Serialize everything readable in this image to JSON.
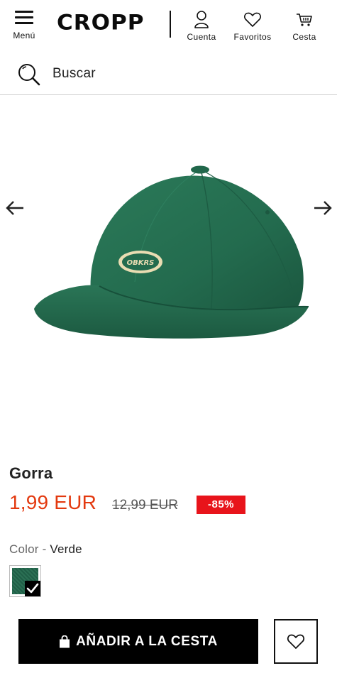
{
  "header": {
    "menu_label": "Menú",
    "logo_text": "CROPP",
    "account_label": "Cuenta",
    "favorites_label": "Favoritos",
    "cart_label": "Cesta"
  },
  "search": {
    "placeholder": "Buscar",
    "icon": "search-icon"
  },
  "gallery": {
    "prev_icon": "arrow-left-icon",
    "next_icon": "arrow-right-icon",
    "image_subject": "green-cap",
    "patch_text": "OBKRS"
  },
  "product": {
    "name": "Gorra",
    "price_current": "1,99 EUR",
    "price_old": "12,99 EUR",
    "discount": "-85%",
    "color_key": "Color",
    "color_separator": "-",
    "color_value": "Verde",
    "swatch_selected": true
  },
  "actions": {
    "add_to_cart_label": "AÑADIR A LA CESTA",
    "add_to_cart_icon": "shopping-bag-icon",
    "wishlist_icon": "heart-icon"
  },
  "colors": {
    "accent_price": "#e3390f",
    "discount_bg": "#e8141b",
    "button_bg": "#000000",
    "cap_green": "#236b4e"
  }
}
